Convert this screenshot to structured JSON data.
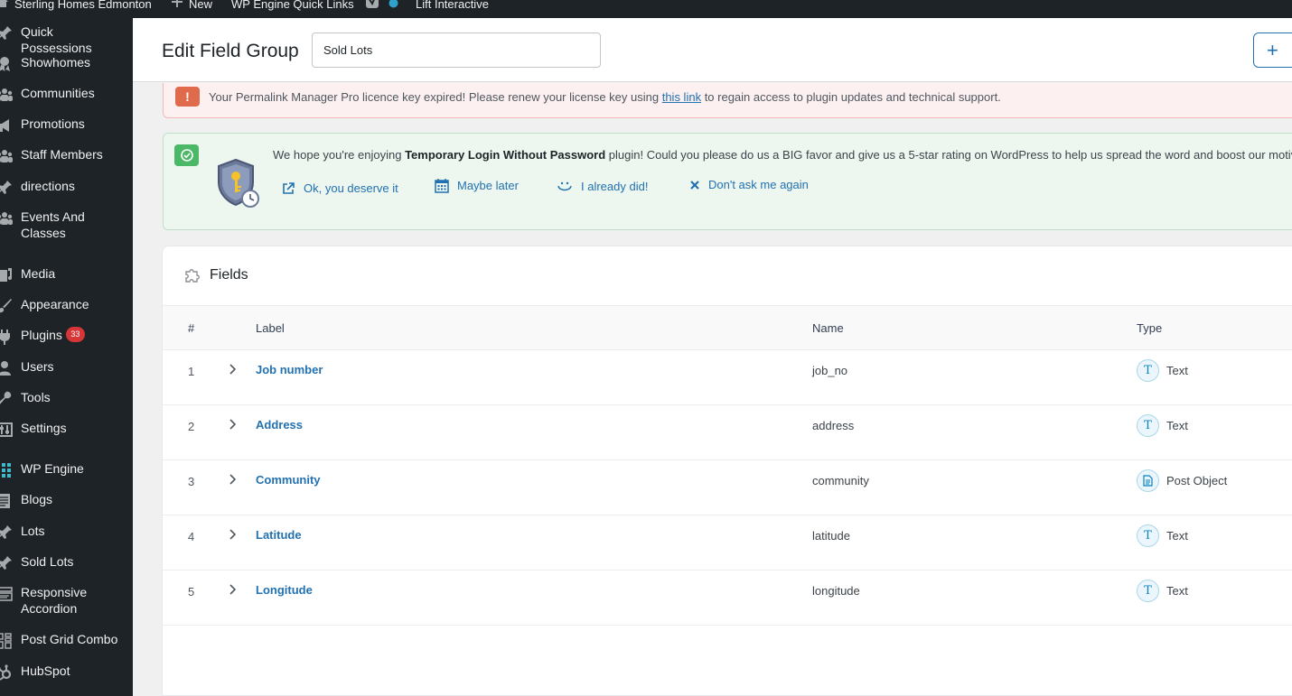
{
  "admin_bar": {
    "site_name": "Sterling Homes Edmonton",
    "new_label": "New",
    "quick_links": "WP Engine Quick Links",
    "lift": "Lift Interactive"
  },
  "sidebar": {
    "items": [
      {
        "label": "Quick Possessions",
        "icon": "pin-icon"
      },
      {
        "label": "Showhomes",
        "icon": "award-icon"
      },
      {
        "label": "Communities",
        "icon": "groups-icon"
      },
      {
        "label": "Promotions",
        "icon": "megaphone-icon"
      },
      {
        "label": "Staff Members",
        "icon": "groups-icon"
      },
      {
        "label": "directions",
        "icon": "pin-icon"
      },
      {
        "label": "Events And Classes",
        "icon": "groups-icon"
      },
      {
        "label": "Media",
        "icon": "media-icon"
      },
      {
        "label": "Appearance",
        "icon": "brush-icon"
      },
      {
        "label": "Plugins",
        "icon": "plugin-icon",
        "badge": "33"
      },
      {
        "label": "Users",
        "icon": "user-icon"
      },
      {
        "label": "Tools",
        "icon": "wrench-icon"
      },
      {
        "label": "Settings",
        "icon": "settings-icon"
      },
      {
        "label": "WP Engine",
        "icon": "grid-icon"
      },
      {
        "label": "Blogs",
        "icon": "blogs-icon"
      },
      {
        "label": "Lots",
        "icon": "pin-icon"
      },
      {
        "label": "Sold Lots",
        "icon": "pin-icon"
      },
      {
        "label": "Responsive Accordion",
        "icon": "accordion-icon"
      },
      {
        "label": "Post Grid Combo",
        "icon": "grid-combo-icon"
      },
      {
        "label": "HubSpot",
        "icon": "hubspot-icon"
      }
    ]
  },
  "header": {
    "title": "Edit Field Group",
    "group_name": "Sold Lots",
    "add_symbol": "+"
  },
  "notice_license": {
    "icon_symbol": "!",
    "text_before": "Your Permalink Manager Pro licence key expired! Please renew your license key using ",
    "link_text": "this link",
    "text_after": " to regain access to plugin updates and technical support."
  },
  "notice_login": {
    "text_before": "We hope you're enjoying ",
    "plugin_name": "Temporary Login Without Password",
    "text_after": " plugin! Could you please do us a BIG favor and give us a 5-star rating on WordPress to help us spread the word and boost our motivation",
    "links": {
      "deserve": "Ok, you deserve it",
      "later": "Maybe later",
      "already": "I already did!",
      "dont_ask": "Don't ask me again"
    }
  },
  "fields": {
    "title": "Fields",
    "columns": {
      "num": "#",
      "label": "Label",
      "name": "Name",
      "type": "Type"
    },
    "rows": [
      {
        "num": "1",
        "label": "Job number",
        "name": "job_no",
        "type": "Text",
        "type_icon": "T"
      },
      {
        "num": "2",
        "label": "Address",
        "name": "address",
        "type": "Text",
        "type_icon": "T"
      },
      {
        "num": "3",
        "label": "Community",
        "name": "community",
        "type": "Post Object",
        "type_icon": "doc"
      },
      {
        "num": "4",
        "label": "Latitude",
        "name": "latitude",
        "type": "Text",
        "type_icon": "T"
      },
      {
        "num": "5",
        "label": "Longitude",
        "name": "longitude",
        "type": "Text",
        "type_icon": "T"
      }
    ]
  },
  "colors": {
    "admin_dark": "#1d2327",
    "link_blue": "#2271b1",
    "error_orange": "#e06b4c",
    "success_green": "#4ab866",
    "badge_red": "#d63638"
  }
}
